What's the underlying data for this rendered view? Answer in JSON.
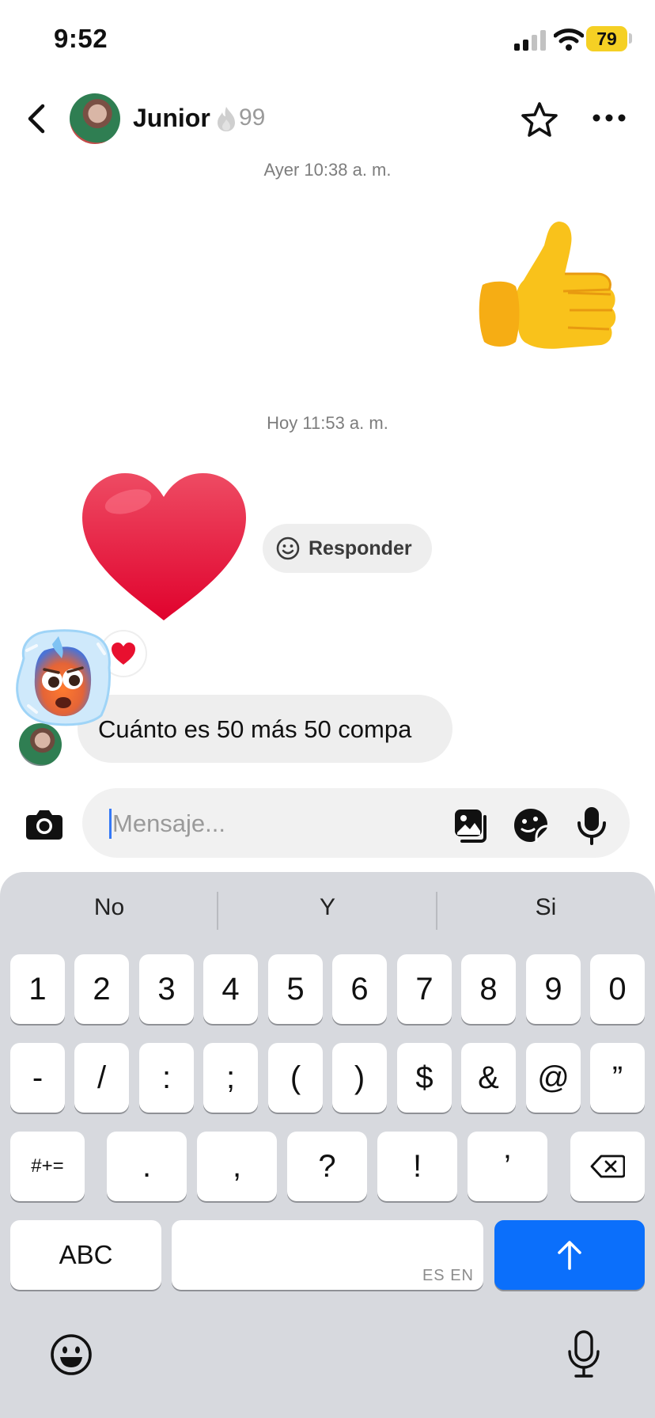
{
  "status_bar": {
    "time": "9:52",
    "battery": "79"
  },
  "header": {
    "contact_name": "Junior",
    "streak_count": "99",
    "icons": [
      "back-chevron-icon",
      "avatar",
      "flame-icon",
      "star-icon",
      "more-icon"
    ]
  },
  "conversation": {
    "timestamp_1": "Ayer 10:38 a. m.",
    "sent_emoji": "👍",
    "timestamp_2": "Hoy 11:53 a. m.",
    "received_emoji": "❤️",
    "reply_button_label": "Responder",
    "reaction": "❤️",
    "received_message": "Cuánto es 50 más 50 compa"
  },
  "composer": {
    "placeholder": "Mensaje...",
    "value": ""
  },
  "keyboard": {
    "suggestions": [
      "No",
      "Y",
      "Si"
    ],
    "row1": [
      "1",
      "2",
      "3",
      "4",
      "5",
      "6",
      "7",
      "8",
      "9",
      "0"
    ],
    "row2": [
      "-",
      "/",
      ":",
      ";",
      "(",
      ")",
      "$",
      "&",
      "@",
      "”"
    ],
    "row3_left": "#+=",
    "row3": [
      ".",
      ",",
      "?",
      "!",
      "’"
    ],
    "abc_label": "ABC",
    "space_languages": "ES EN"
  },
  "colors": {
    "accent": "#0b6ffb",
    "battery": "#f5d024",
    "bubble": "#eeeeee",
    "keyboard": "#d7d9de"
  }
}
